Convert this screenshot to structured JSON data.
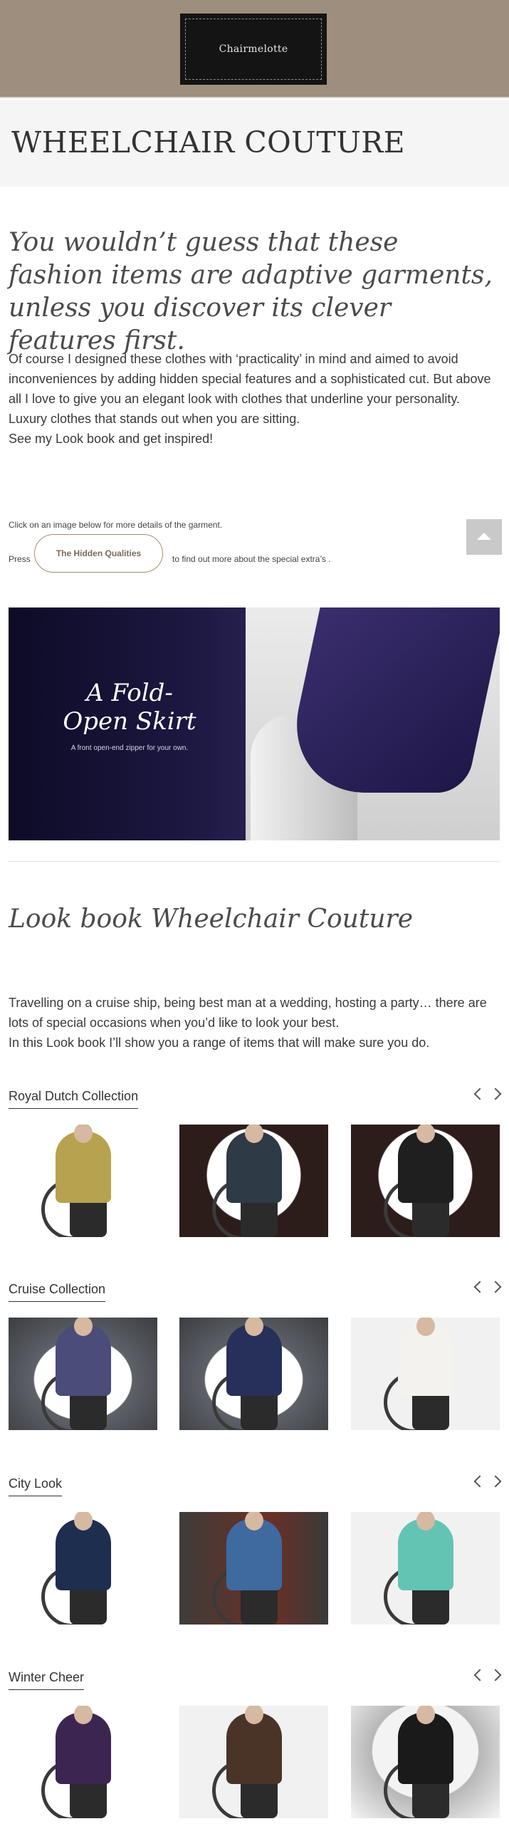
{
  "brand": {
    "logo_text": "Chairmelotte"
  },
  "page": {
    "title": "WHEELCHAIR COUTURE"
  },
  "tagline": "You wouldn’t guess that these fashion items are adaptive garments, unless you discover its clever features first.",
  "intro": {
    "p1": "Of course I designed these clothes with ‘practicality’ in mind and aimed to avoid inconveniences by adding hidden special features and a sophisticated cut. But above all I love to give you an elegant look with clothes that underline your personality.",
    "p2": "Luxury clothes that stands out when you are sitting.",
    "p3": "See my Look book and get inspired!"
  },
  "instructions": {
    "click_note": "Click on an image below for more details of the garment.",
    "press": "Press",
    "button": "The Hidden Qualities",
    "suffix": "to find out more about the special extra’s ."
  },
  "banner": {
    "title_line1": "A Fold-",
    "title_line2": "Open Skirt",
    "subtitle": "A front open-end zipper for your own."
  },
  "lookbook": {
    "title": "Look book Wheelchair Couture",
    "p1": "Travelling on a cruise ship, being best man at a wedding, hosting a party… there are lots of special occasions when you’d like to look your best.",
    "p2": "In this Look book I’ll show you a range of items that will make sure you do."
  },
  "collections": [
    {
      "title": "Royal Dutch Collection",
      "items": [
        {
          "body_color": "#b7a24f",
          "bg": "white"
        },
        {
          "body_color": "#2e3a46",
          "bg": "stage"
        },
        {
          "body_color": "#1f1f1f",
          "bg": "stage"
        }
      ]
    },
    {
      "title": "Cruise Collection",
      "items": [
        {
          "body_color": "#4a4d7a",
          "bg": "sea"
        },
        {
          "body_color": "#26305a",
          "bg": "sea"
        },
        {
          "body_color": "#f4f2ee",
          "bg": "light"
        }
      ]
    },
    {
      "title": "City Look",
      "items": [
        {
          "body_color": "#1e2e4f",
          "bg": "white"
        },
        {
          "body_color": "#3e6aa0",
          "bg": "brick"
        },
        {
          "body_color": "#64c4b4",
          "bg": "light"
        }
      ]
    },
    {
      "title": "Winter Cheer",
      "items": [
        {
          "body_color": "#3d2552",
          "bg": "white"
        },
        {
          "body_color": "#4a3428",
          "bg": "light"
        },
        {
          "body_color": "#1a1a1a",
          "bg": "snow"
        }
      ]
    }
  ]
}
